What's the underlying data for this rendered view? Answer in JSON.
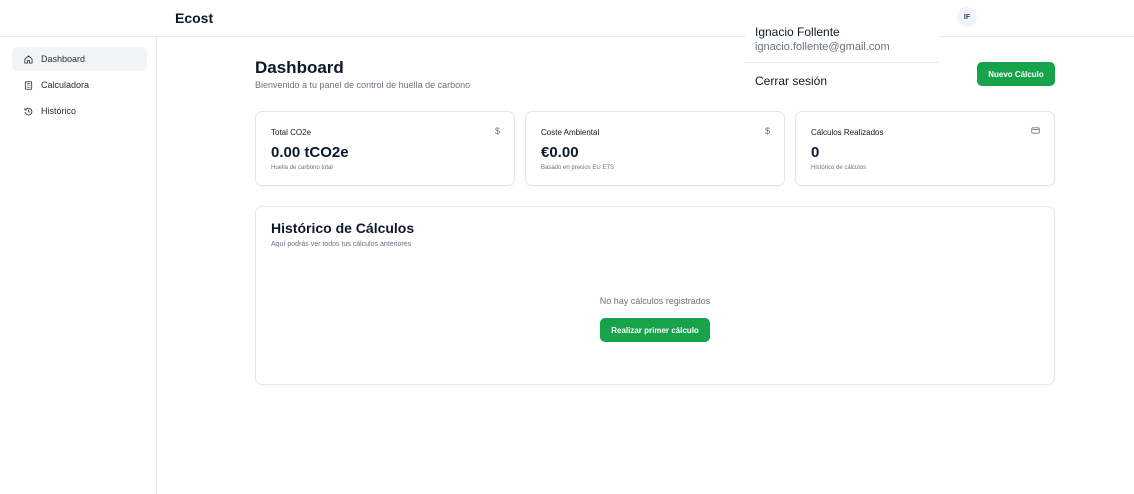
{
  "app": {
    "brand": "Ecost"
  },
  "user": {
    "initials": "IF",
    "name": "Ignacio Follente",
    "email": "ignacio.follente@gmail.com",
    "logout_label": "Cerrar sesión"
  },
  "sidebar": {
    "items": [
      {
        "label": "Dashboard",
        "icon": "home-icon",
        "active": true
      },
      {
        "label": "Calculadora",
        "icon": "calculator-icon",
        "active": false
      },
      {
        "label": "Histórico",
        "icon": "history-icon",
        "active": false
      }
    ]
  },
  "header": {
    "title": "Dashboard",
    "subtitle": "Bienvenido a tu panel de control de huella de carbono",
    "new_button": "Nuevo Cálculo"
  },
  "cards": [
    {
      "title": "Total CO2e",
      "icon": "dollar-icon",
      "value": "0.00 tCO2e",
      "desc": "Huella de carbono total"
    },
    {
      "title": "Coste Ambiental",
      "icon": "dollar-icon",
      "value": "€0.00",
      "desc": "Basado en precios EU ETS"
    },
    {
      "title": "Cálculos Realizados",
      "icon": "card-icon",
      "value": "0",
      "desc": "Histórico de cálculos"
    }
  ],
  "history": {
    "title": "Histórico de Cálculos",
    "subtitle": "Aquí podrás ver todos tus cálculos anteriores",
    "empty_text": "No hay cálculos registrados",
    "first_button": "Realizar primer cálculo"
  },
  "colors": {
    "accent": "#16a34a",
    "muted_text": "#6b7280",
    "border": "#e5e7eb",
    "active_nav": "#f3f4f6"
  }
}
